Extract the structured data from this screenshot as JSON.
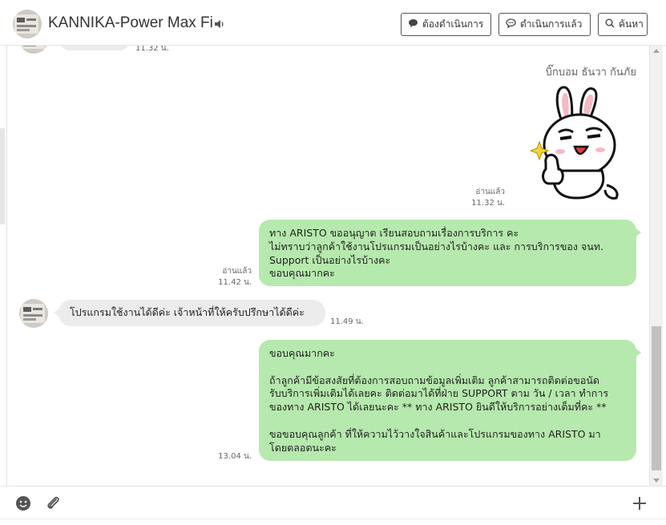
{
  "header": {
    "title": "KANNIKA-Power Max Fi",
    "buttons": {
      "todo": "ต้องดำเนินการ",
      "done": "ดำเนินการแล้ว",
      "search": "ค้นหา"
    }
  },
  "chat": {
    "top_partial_time": "11.32 น.",
    "sender_name": "บิ๊กบอม ธันวา กันภัย",
    "sticker_meta": {
      "read": "อ่านแล้ว",
      "time": "11.32 น."
    },
    "msg1": {
      "text": "ทาง ARISTO ขออนุญาต เรียนสอบถามเรื่องการบริการ คะ\nไม่ทราบว่าลูกค้าใช้งานโปรแกรมเป็นอย่างไรบ้างคะ และ การบริการของ จนท.\nSupport เป็นอย่างไรบ้างคะ\nขอบคุณมากคะ",
      "read": "อ่านแล้ว",
      "time": "11.42 น."
    },
    "msg2": {
      "text": "โปรแกรมใช้งานได้ดีค่ะ เจ้าหน้าที่ให้ครับปรึกษาได้ดีค่ะ",
      "time": "11.49 น."
    },
    "msg3": {
      "text": "ขอบคุณมากคะ\n\nถ้าลูกค้ามีข้อสงสัยที่ต้องการสอบถามข้อมูลเพิ่มเติม ลูกค้าสามารถติดต่อขอนัด\nรับบริการเพิ่มเติมได้เลยคะ ติดต่อมาได้ที่ฝ่าย SUPPORT ตาม วัน / เวลา ทำการ\nของทาง ARISTO ได้เลยนะคะ ** ทาง ARISTO ยินดีให้บริการอย่างเต็มที่คะ **\n\nขอขอบคุณลูกค้า ที่ให้ความไว้วางใจสินค้าและโปรแกรมของทาง ARISTO มา\nโดยตลอดนะคะ",
      "time": "13.04 น."
    }
  },
  "colors": {
    "outgoing_bubble": "#b6e9ad",
    "incoming_bubble": "#ececec"
  },
  "icons": [
    "speaker-icon",
    "todo-bubble-icon",
    "done-bubble-icon",
    "search-icon",
    "emoji-icon",
    "attach-icon",
    "plus-icon"
  ]
}
